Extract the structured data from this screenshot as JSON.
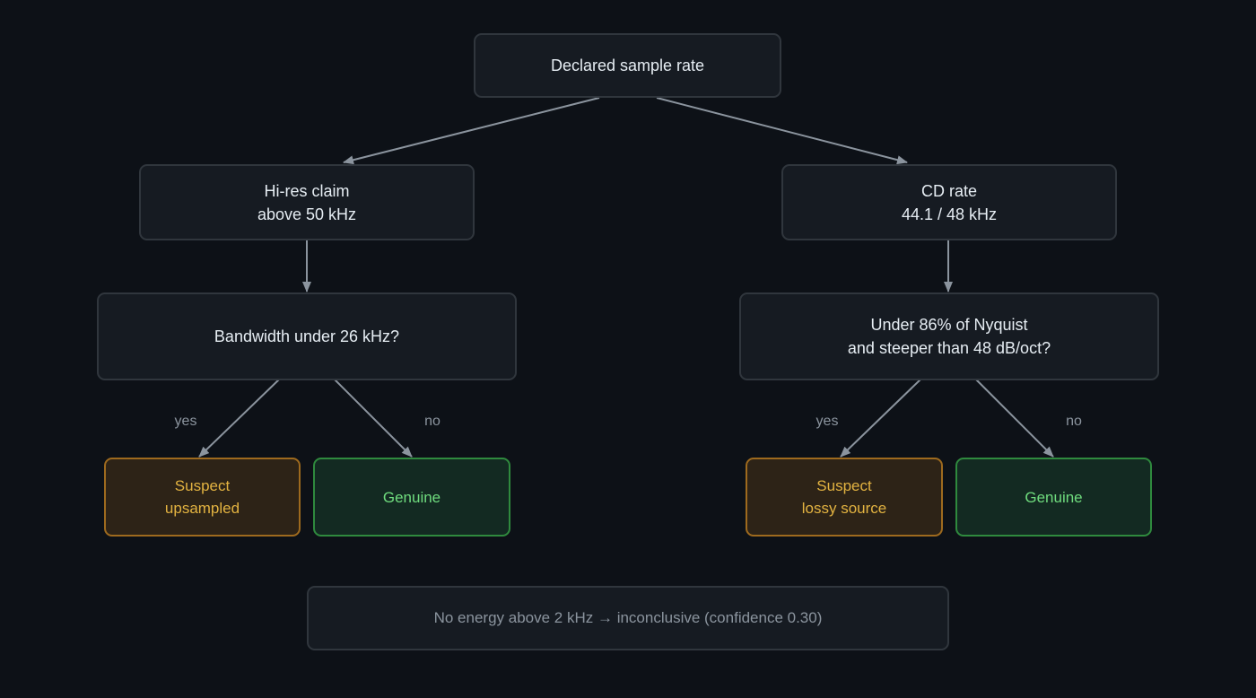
{
  "nodes": {
    "root": {
      "line1": "Declared sample rate"
    },
    "hires": {
      "line1": "Hi-res claim",
      "line2": "above 50 kHz"
    },
    "cd": {
      "line1": "CD rate",
      "line2": "44.1 / 48 kHz"
    },
    "bandwidth_q": {
      "line1": "Bandwidth under 26 kHz?"
    },
    "nyquist_q": {
      "line1": "Under 86% of Nyquist",
      "line2": "and steeper than 48 dB/oct?"
    },
    "upsampled": {
      "line1": "Suspect",
      "line2": "upsampled"
    },
    "genuine_left": {
      "line1": "Genuine"
    },
    "lossy": {
      "line1": "Suspect",
      "line2": "lossy source"
    },
    "genuine_right": {
      "line1": "Genuine"
    },
    "note": {
      "line1": "No energy above 2 kHz → inconclusive (confidence 0.30)"
    }
  },
  "edge_labels": {
    "left_yes": "yes",
    "left_no": "no",
    "right_yes": "yes",
    "right_no": "no"
  },
  "colors": {
    "background": "#0d1117",
    "node_fill": "#161b22",
    "node_border": "#30363d",
    "edge": "#8b949e",
    "suspect_border": "#9e6a1e",
    "suspect_text": "#e3b341",
    "genuine_border": "#2f8a3e",
    "genuine_text": "#6fdc7e"
  }
}
